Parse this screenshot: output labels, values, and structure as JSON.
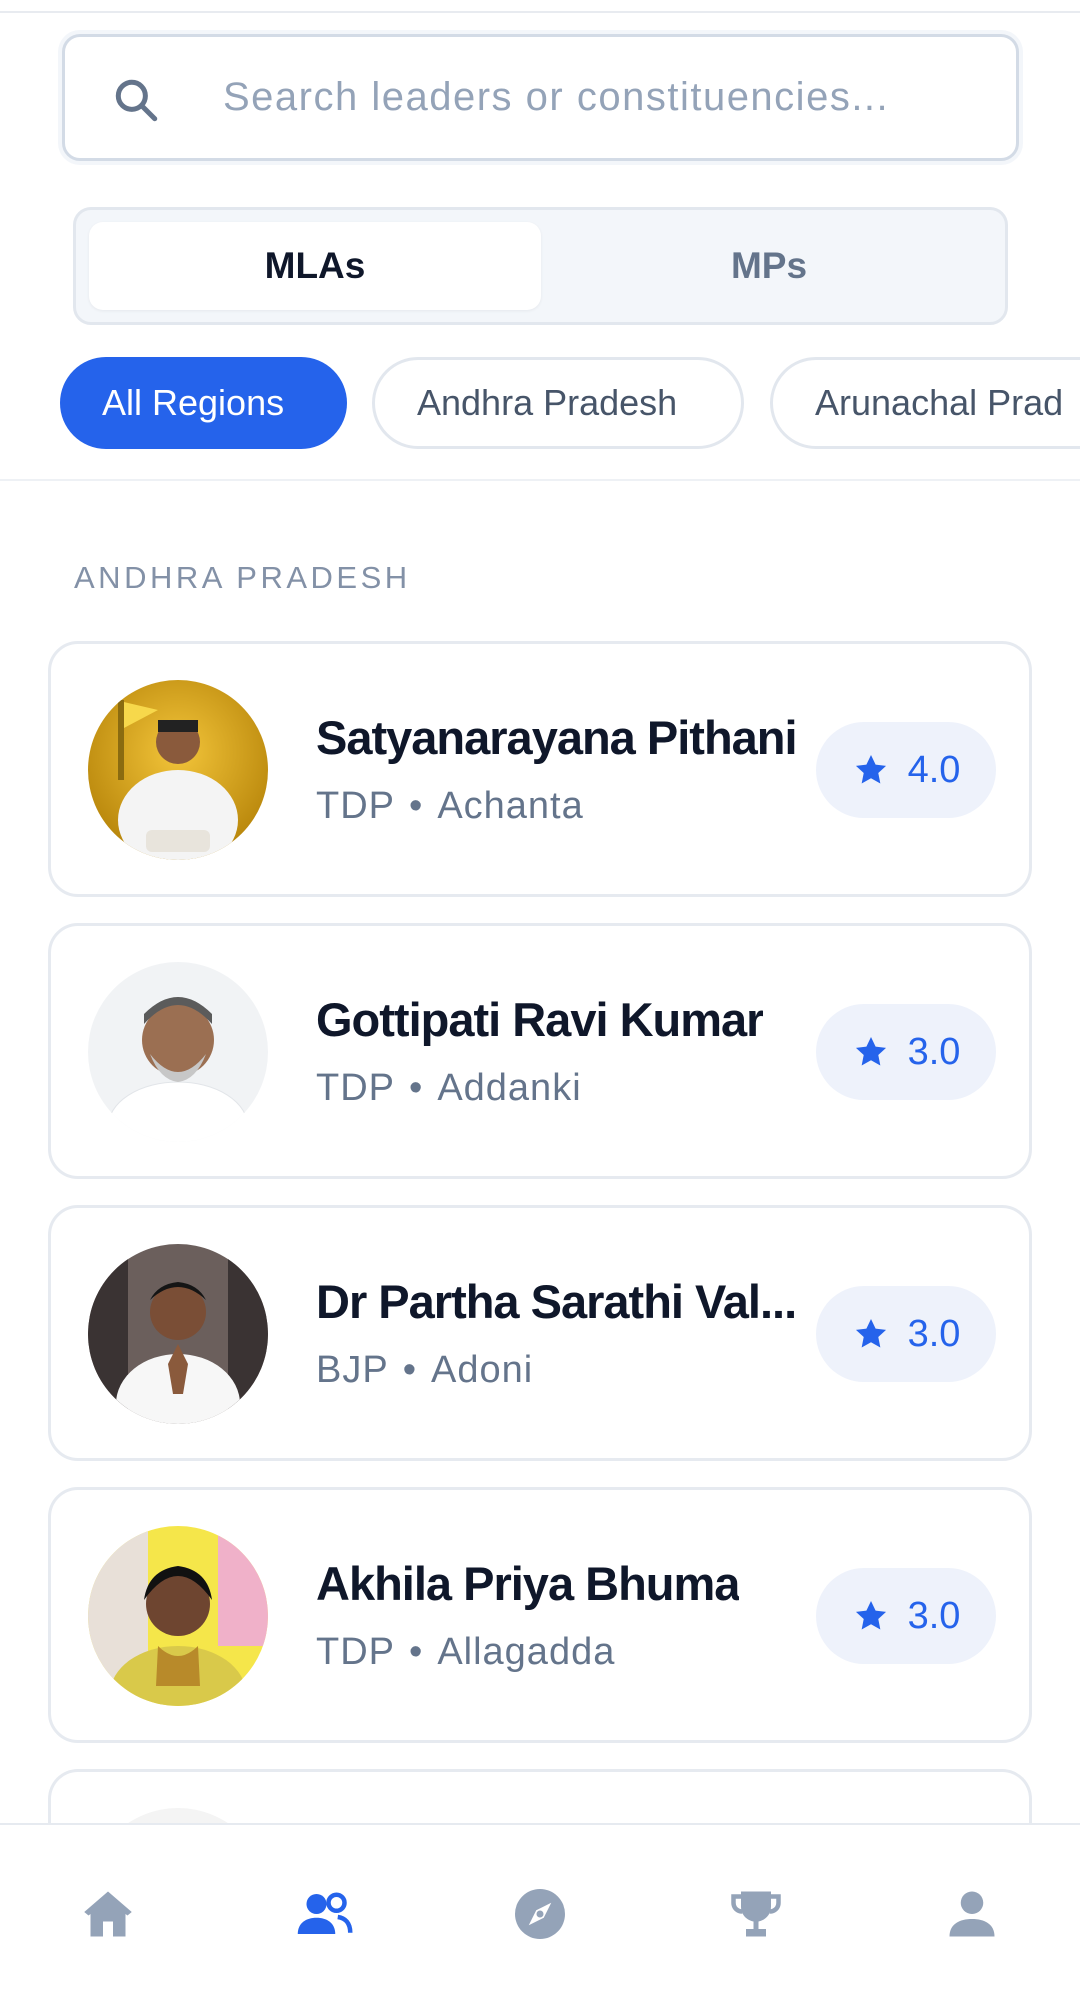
{
  "search": {
    "placeholder": "Search leaders or constituencies..."
  },
  "tabs": [
    {
      "label": "MLAs",
      "selected": true
    },
    {
      "label": "MPs",
      "selected": false
    }
  ],
  "regions": [
    {
      "label": "All Regions",
      "selected": true
    },
    {
      "label": "Andhra Pradesh",
      "selected": false
    },
    {
      "label": "Arunachal Prad",
      "selected": false
    }
  ],
  "section": {
    "title": "ANDHRA PRADESH"
  },
  "leaders": [
    {
      "name": "Satyanarayana Pithani",
      "party": "TDP",
      "constituency": "Achanta",
      "rating": "4.0"
    },
    {
      "name": "Gottipati Ravi Kumar",
      "party": "TDP",
      "constituency": "Addanki",
      "rating": "3.0"
    },
    {
      "name": "Dr Partha Sarathi Val...",
      "party": "BJP",
      "constituency": "Adoni",
      "rating": "3.0"
    },
    {
      "name": "Akhila Priya Bhuma",
      "party": "TDP",
      "constituency": "Allagadda",
      "rating": "3.0"
    }
  ],
  "meta_separator": "•",
  "colors": {
    "accent": "#2563eb",
    "rating_bg": "#eef2fb",
    "muted_text": "#64748b",
    "nav_inactive": "#94a3b8"
  },
  "bottom_nav": [
    {
      "icon": "home-icon",
      "active": false
    },
    {
      "icon": "users-icon",
      "active": true
    },
    {
      "icon": "compass-icon",
      "active": false
    },
    {
      "icon": "trophy-icon",
      "active": false
    },
    {
      "icon": "profile-icon",
      "active": false
    }
  ]
}
